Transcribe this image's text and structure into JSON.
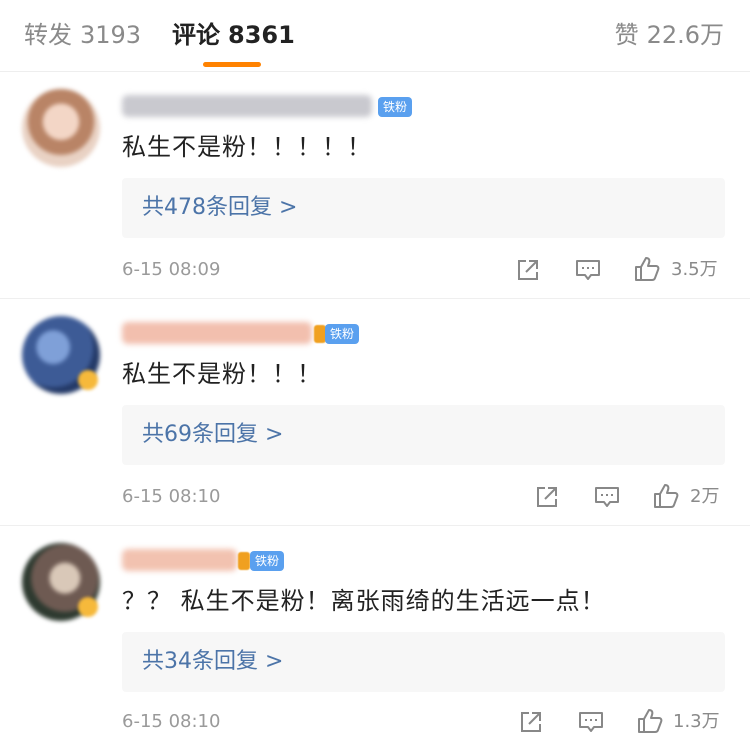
{
  "tabs": {
    "repost": {
      "label": "转发",
      "count": "3193"
    },
    "comments": {
      "label": "评论",
      "count": "8361"
    },
    "likes": {
      "label": "赞",
      "count": "22.6万"
    }
  },
  "comments": [
    {
      "badge": "铁粉",
      "text": "私生不是粉！！！！！",
      "replies": "共478条回复 >",
      "time": "6-15 08:09",
      "likes": "3.5万"
    },
    {
      "badge": "铁粉",
      "text": "私生不是粉！！！",
      "replies": "共69条回复 >",
      "time": "6-15 08:10",
      "likes": "2万"
    },
    {
      "badge": "铁粉",
      "text": "？？ 私生不是粉！离张雨绮的生活远一点！",
      "replies": "共34条回复 >",
      "time": "6-15 08:10",
      "likes": "1.3万"
    }
  ],
  "colors": {
    "accent": "#ff8200",
    "link": "#4c74a8",
    "fan_badge": "#5aa0ef"
  },
  "icons": [
    "share-icon",
    "comment-icon",
    "like-icon"
  ]
}
